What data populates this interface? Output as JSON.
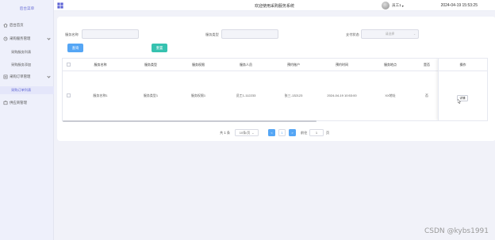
{
  "sidebar": {
    "logo": "后台菜单",
    "items": [
      {
        "label": "后台首页",
        "icon": "home-icon"
      },
      {
        "label": "采购服务管理",
        "icon": "shop-icon",
        "children": [
          "采购服务列表",
          "采购服务添加"
        ]
      },
      {
        "label": "采购订单管理",
        "icon": "order-icon",
        "children": [
          "采购订单列表"
        ]
      },
      {
        "label": "供应商管理",
        "icon": "supplier-icon"
      }
    ]
  },
  "header": {
    "title": "欢迎使用采购服务系统",
    "user": "员工1",
    "datetime": "2024-04-19 15:53:25"
  },
  "search": {
    "service_name_label": "服务名称",
    "service_type_label": "服务类型",
    "pay_status_label": "支付状态",
    "pay_status_placeholder": "请选择",
    "search_btn": "查询",
    "reset_btn": "重置"
  },
  "table": {
    "columns": [
      "服务名称",
      "服务类型",
      "服务权限",
      "服务人员",
      "预约账户",
      "预约时间",
      "服务地点",
      "是否",
      "操作"
    ],
    "rows": [
      {
        "cells": [
          "服务名称1",
          "服务类型1",
          "服务权限1",
          "员工1-112233",
          "张三-132123",
          "2024-04-19 10:53:00",
          "XX地址",
          "否"
        ],
        "action": "详情"
      }
    ]
  },
  "pagination": {
    "total": "共 1 条",
    "page_size": "10条/页",
    "prev": "<",
    "page": "1",
    "next": ">",
    "goto_label": "前往",
    "goto_value": "1",
    "page_suffix": "页"
  },
  "watermark": "CSDN @kybs1991",
  "colors": {
    "primary": "#55a6f5",
    "reset": "#36c2b0",
    "accent": "#5b61d4"
  }
}
